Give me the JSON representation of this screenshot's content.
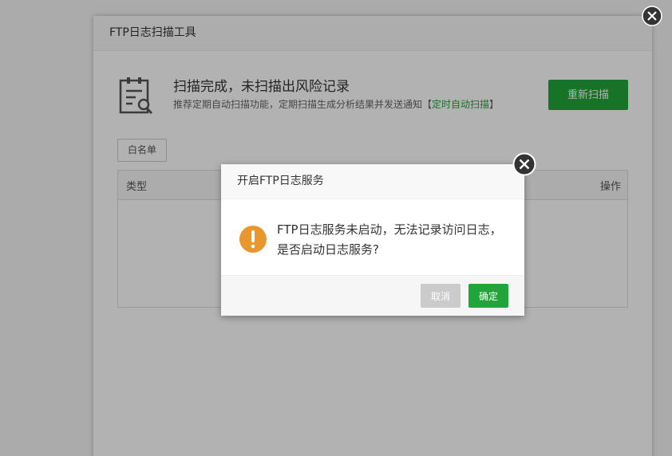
{
  "tool": {
    "title": "FTP日志扫描工具",
    "status_title": "扫描完成，未扫描出风险记录",
    "status_sub_prefix": "推荐定期自动扫描功能，定期扫描生成分析结果并发送通知【",
    "status_sub_link": "定时自动扫描",
    "status_sub_suffix": "】",
    "rescan_label": "重新扫描",
    "whitelist_label": "白名单",
    "table": {
      "columns": [
        "类型",
        "操作"
      ]
    }
  },
  "dialog": {
    "title": "开启FTP日志服务",
    "message_line1": "FTP日志服务未启动，无法记录访问日志，",
    "message_line2": "是否启动日志服务?",
    "cancel_label": "取消",
    "ok_label": "确定"
  },
  "icons": {
    "status": "document-search-icon",
    "warning": "exclamation-icon",
    "close": "close-icon"
  },
  "colors": {
    "accent": "#20a53a",
    "warning": "#e8962e",
    "close_bg": "#333333"
  }
}
